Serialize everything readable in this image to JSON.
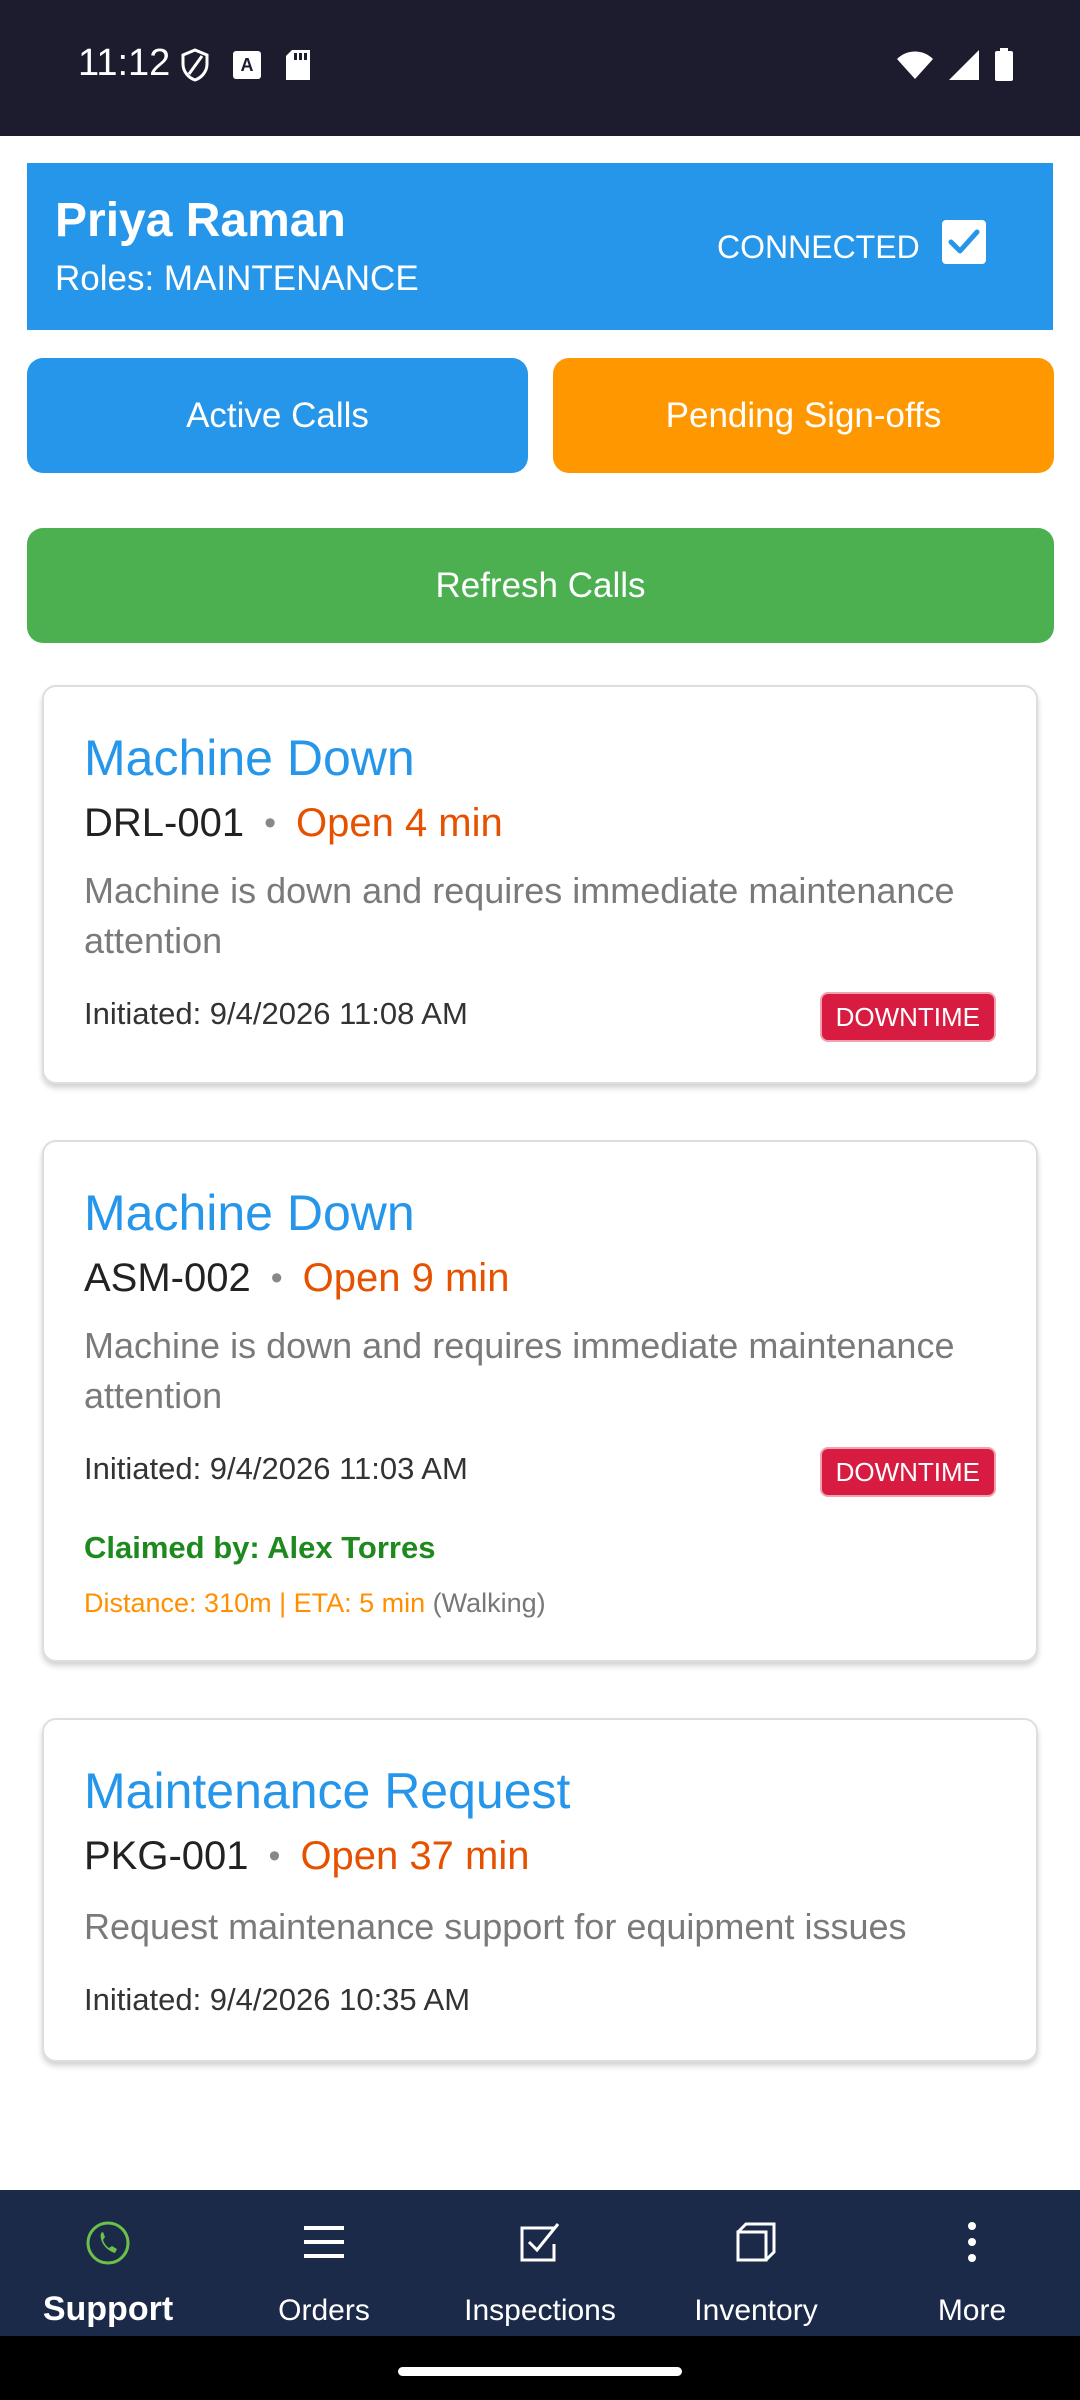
{
  "status_bar": {
    "time": "11:12",
    "icons": [
      "shield-icon",
      "a-box-icon",
      "sd-card-icon",
      "wifi-icon",
      "signal-icon",
      "battery-icon"
    ]
  },
  "header": {
    "name": "Priya Raman",
    "roles": "Roles: MAINTENANCE",
    "connection_label": "CONNECTED",
    "connected": true
  },
  "buttons": {
    "active_calls": "Active Calls",
    "pending_signoffs": "Pending Sign-offs",
    "refresh_calls": "Refresh Calls"
  },
  "calls": [
    {
      "title": "Machine Down",
      "machine": "DRL-001",
      "separator": "•",
      "open": "Open 4 min",
      "description": "Machine is down and requires immediate maintenance attention",
      "initiated": "Initiated: 9/4/2026 11:08 AM",
      "badge": "DOWNTIME"
    },
    {
      "title": "Machine Down",
      "machine": "ASM-002",
      "separator": "•",
      "open": "Open 9 min",
      "description": "Machine is down and requires immediate maintenance attention",
      "initiated": "Initiated: 9/4/2026 11:03 AM",
      "badge": "DOWNTIME",
      "claimed_by": "Claimed by: Alex Torres",
      "distance": "Distance: 310m | ETA: 5 min",
      "mode": "(Walking)"
    },
    {
      "title": "Maintenance Request",
      "machine": "PKG-001",
      "separator": "•",
      "open": "Open 37 min",
      "description": "Request maintenance support for equipment issues",
      "initiated": "Initiated: 9/4/2026 10:35 AM"
    }
  ],
  "nav": [
    {
      "label": "Support",
      "icon": "phone-icon",
      "active": true
    },
    {
      "label": "Orders",
      "icon": "menu-icon"
    },
    {
      "label": "Inspections",
      "icon": "checkbox-icon"
    },
    {
      "label": "Inventory",
      "icon": "box-icon"
    },
    {
      "label": "More",
      "icon": "more-vertical-icon"
    }
  ],
  "colors": {
    "primary": "#2596ea",
    "warning": "#ff9800",
    "success": "#4caf50",
    "badge": "#d81b40",
    "open_time": "#e65100",
    "nav_bg": "#1c2a4a"
  }
}
